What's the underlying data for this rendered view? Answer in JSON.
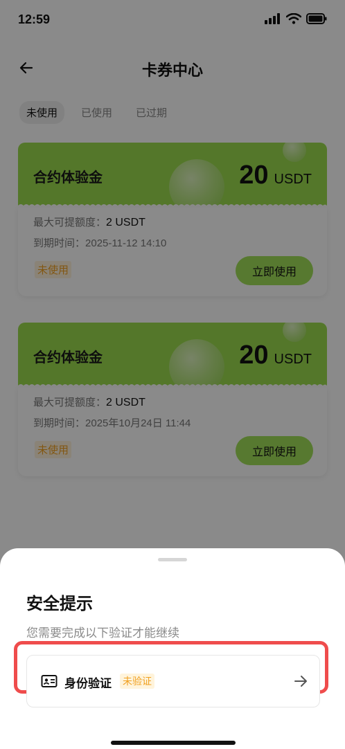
{
  "status_bar": {
    "time": "12:59"
  },
  "header": {
    "title": "卡券中心"
  },
  "tabs": [
    {
      "label": "未使用",
      "active": true
    },
    {
      "label": "已使用",
      "active": false
    },
    {
      "label": "已过期",
      "active": false
    }
  ],
  "coupons": [
    {
      "name": "合约体验金",
      "amount": "20",
      "unit": "USDT",
      "max_label": "最大可提额度：",
      "max_value": "2 USDT",
      "expire_label": "到期时间：",
      "expire_value": "2025-11-12 14:10",
      "status": "未使用",
      "button": "立即使用"
    },
    {
      "name": "合约体验金",
      "amount": "20",
      "unit": "USDT",
      "max_label": "最大可提额度：",
      "max_value": "2 USDT",
      "expire_label": "到期时间：",
      "expire_value": "2025年10月24日 11:44",
      "status": "未使用",
      "button": "立即使用"
    }
  ],
  "sheet": {
    "title": "安全提示",
    "subtitle": "您需要完成以下验证才能继续",
    "item": {
      "label": "身份验证",
      "badge": "未验证"
    }
  },
  "colors": {
    "accent_green": "#9bdd4f",
    "badge_orange": "#f0a020",
    "highlight_red": "#ef4c4c"
  }
}
